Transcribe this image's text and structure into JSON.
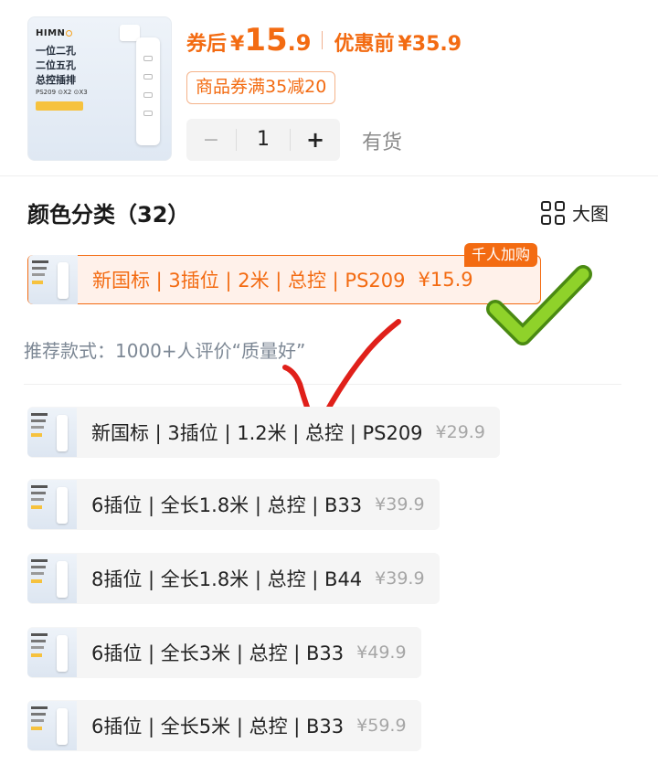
{
  "header": {
    "brand": "HIMN",
    "thumb_lines": [
      "一位二孔",
      "二位五孔",
      "总控插排"
    ],
    "thumb_badges": "PS209  ⊙X2  ⊙X3",
    "coupon_price_label": "券后",
    "currency": "¥",
    "coupon_price_int": "15",
    "coupon_price_dec": ".9",
    "original_price_label": "优惠前",
    "original_price": "¥35.9",
    "coupon_text": "商品券满35减20",
    "quantity": "1",
    "minus_label": "−",
    "plus_label": "+",
    "stock_status": "有货"
  },
  "section": {
    "title": "颜色分类（32）",
    "big_view_label": "大图"
  },
  "selected_option": {
    "label": "新国标 | 3插位 | 2米 | 总控 | PS209",
    "price": "¥15.9",
    "tag": "千人加购"
  },
  "recommend": {
    "text": "推荐款式：1000+人评价“质量好”"
  },
  "options": [
    {
      "label": "新国标 | 3插位 | 1.2米 | 总控 | PS209",
      "price": "¥29.9"
    },
    {
      "label": "6插位 | 全长1.8米 | 总控 | B33",
      "price": "¥39.9"
    },
    {
      "label": "8插位 | 全长1.8米 | 总控 | B44",
      "price": "¥39.9"
    },
    {
      "label": "6插位 | 全长3米 | 总控 | B33",
      "price": "¥49.9"
    },
    {
      "label": "6插位 | 全长5米 | 总控 | B33",
      "price": "¥59.9"
    }
  ],
  "colors": {
    "accent": "#f36b12",
    "selected_bg": "#fff1ea",
    "option_bg": "#f5f5f5",
    "muted": "#a6a6a6",
    "green_check": "#7ac41f",
    "red_check": "#e0201a"
  }
}
